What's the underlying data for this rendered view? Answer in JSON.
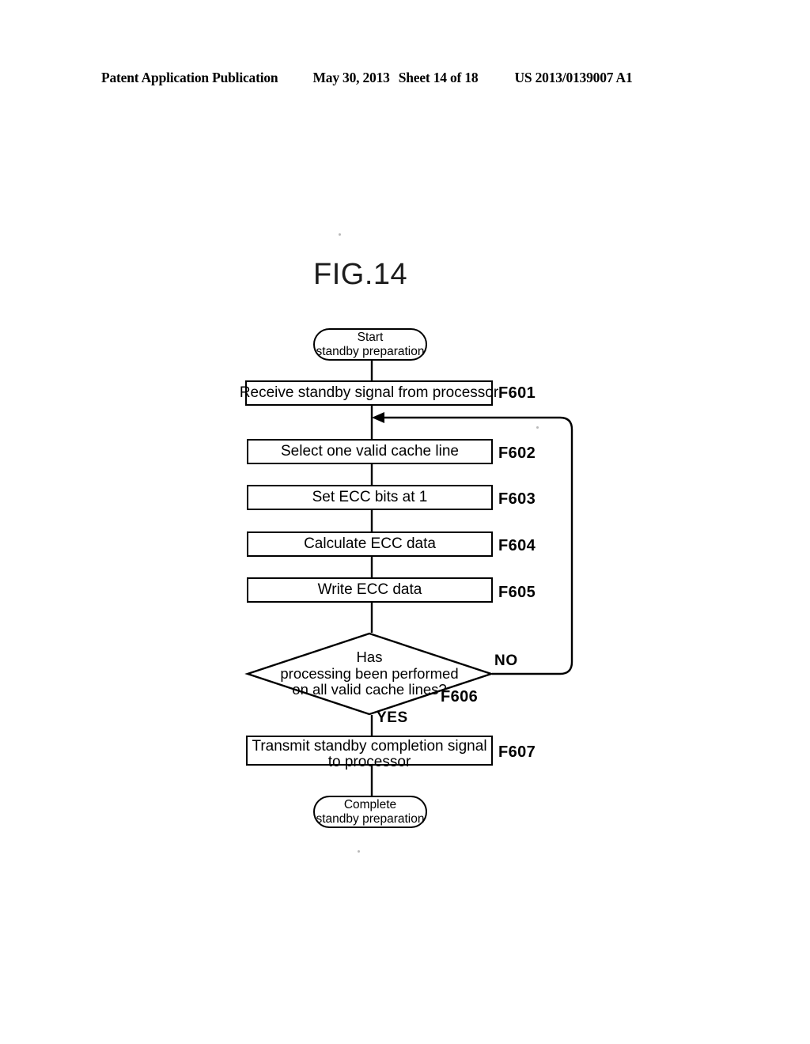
{
  "header": {
    "publication": "Patent Application Publication",
    "date": "May 30, 2013",
    "sheet": "Sheet 14 of 18",
    "number": "US 2013/0139007 A1"
  },
  "figure": {
    "title": "FIG.14"
  },
  "flowchart": {
    "start": {
      "line1": "Start",
      "line2": "standby preparation"
    },
    "end": {
      "line1": "Complete",
      "line2": "standby preparation"
    },
    "steps": [
      {
        "id": "F601",
        "text": "Receive standby signal from processor",
        "label": "F601"
      },
      {
        "id": "F602",
        "text": "Select one valid cache line",
        "label": "F602"
      },
      {
        "id": "F603",
        "text": "Set ECC bits at 1",
        "label": "F603"
      },
      {
        "id": "F604",
        "text": "Calculate ECC data",
        "label": "F604"
      },
      {
        "id": "F605",
        "text": "Write ECC data",
        "label": "F605"
      }
    ],
    "decision": {
      "id": "F606",
      "label": "F606",
      "line1": "Has",
      "line2": "processing been performed",
      "line3": "on all valid cache lines?",
      "yes_label": "YES",
      "no_label": "NO"
    },
    "final_step": {
      "id": "F607",
      "label": "F607",
      "line1": "Transmit standby completion signal",
      "line2": "to processor"
    }
  },
  "colors": {
    "ink": "#000000",
    "paper": "#ffffff"
  }
}
